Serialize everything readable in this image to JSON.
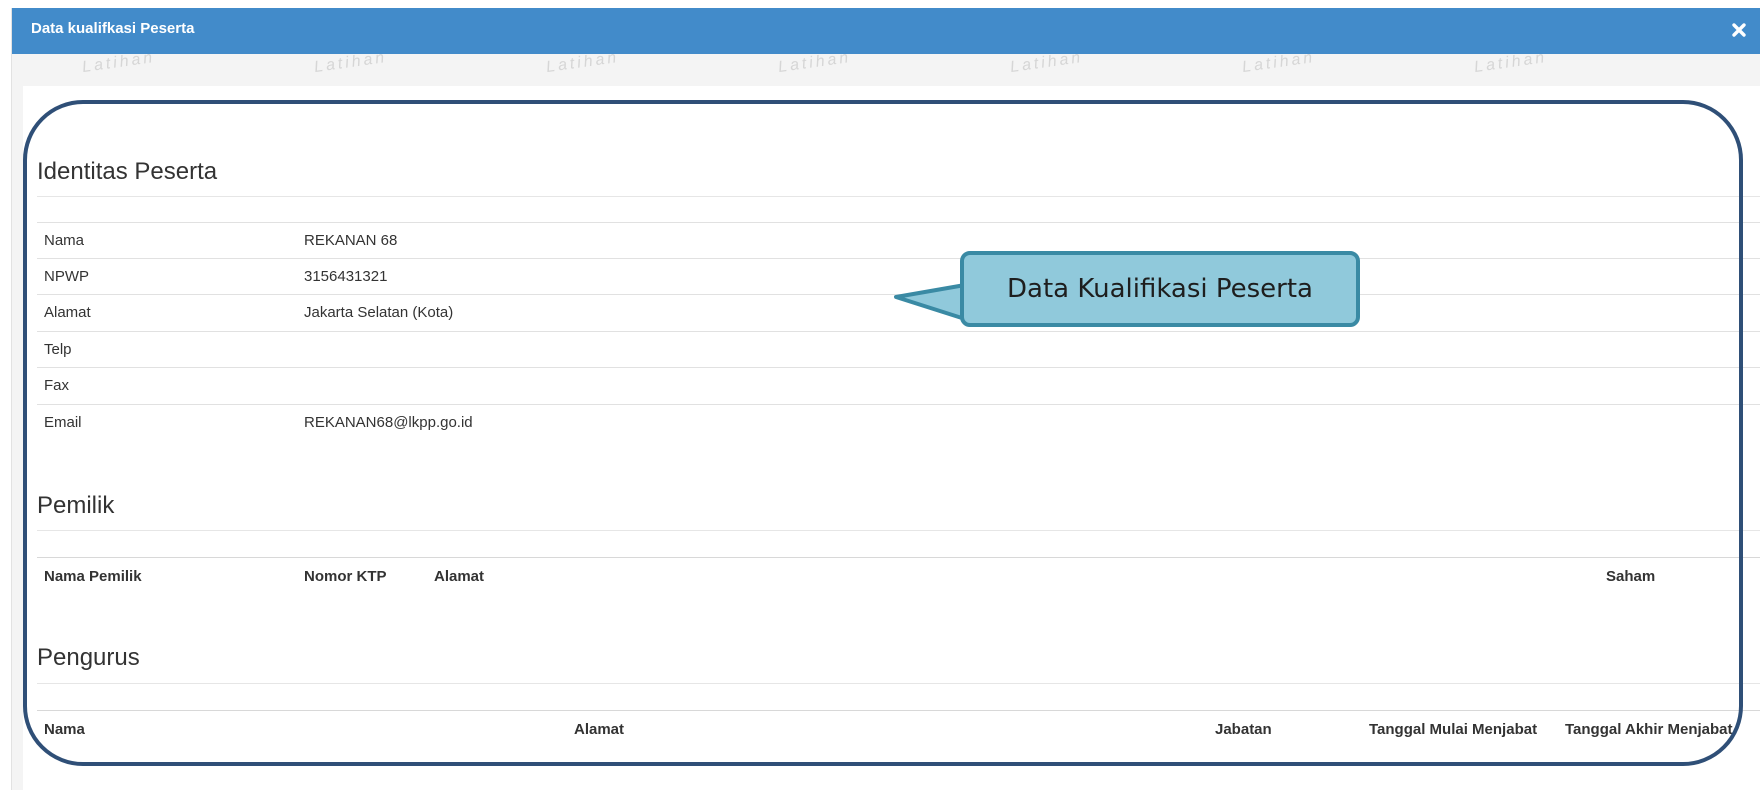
{
  "modal": {
    "title": "Data kualifkasi Peserta",
    "watermark": "Latihan"
  },
  "identitas": {
    "heading": "Identitas Peserta",
    "rows": [
      {
        "label": "Nama",
        "value": "REKANAN 68"
      },
      {
        "label": "NPWP",
        "value": "3156431321"
      },
      {
        "label": "Alamat",
        "value": "Jakarta Selatan (Kota)"
      },
      {
        "label": "Telp",
        "value": ""
      },
      {
        "label": "Fax",
        "value": ""
      },
      {
        "label": "Email",
        "value": "REKANAN68@lkpp.go.id"
      }
    ]
  },
  "pemilik": {
    "heading": "Pemilik",
    "columns": [
      "Nama Pemilik",
      "Nomor KTP",
      "Alamat",
      "Saham"
    ]
  },
  "pengurus": {
    "heading": "Pengurus",
    "columns": [
      "Nama",
      "Alamat",
      "Jabatan",
      "Tanggal Mulai Menjabat",
      "Tanggal Akhir Menjabat"
    ]
  },
  "callout": {
    "text": "Data Kualifikasi Peserta"
  },
  "colors": {
    "header": "#428bca",
    "outline": "#2f4f77",
    "callout_fill": "#90c9db",
    "callout_border": "#3a8aa4"
  },
  "icons": {
    "close": "close-icon"
  }
}
